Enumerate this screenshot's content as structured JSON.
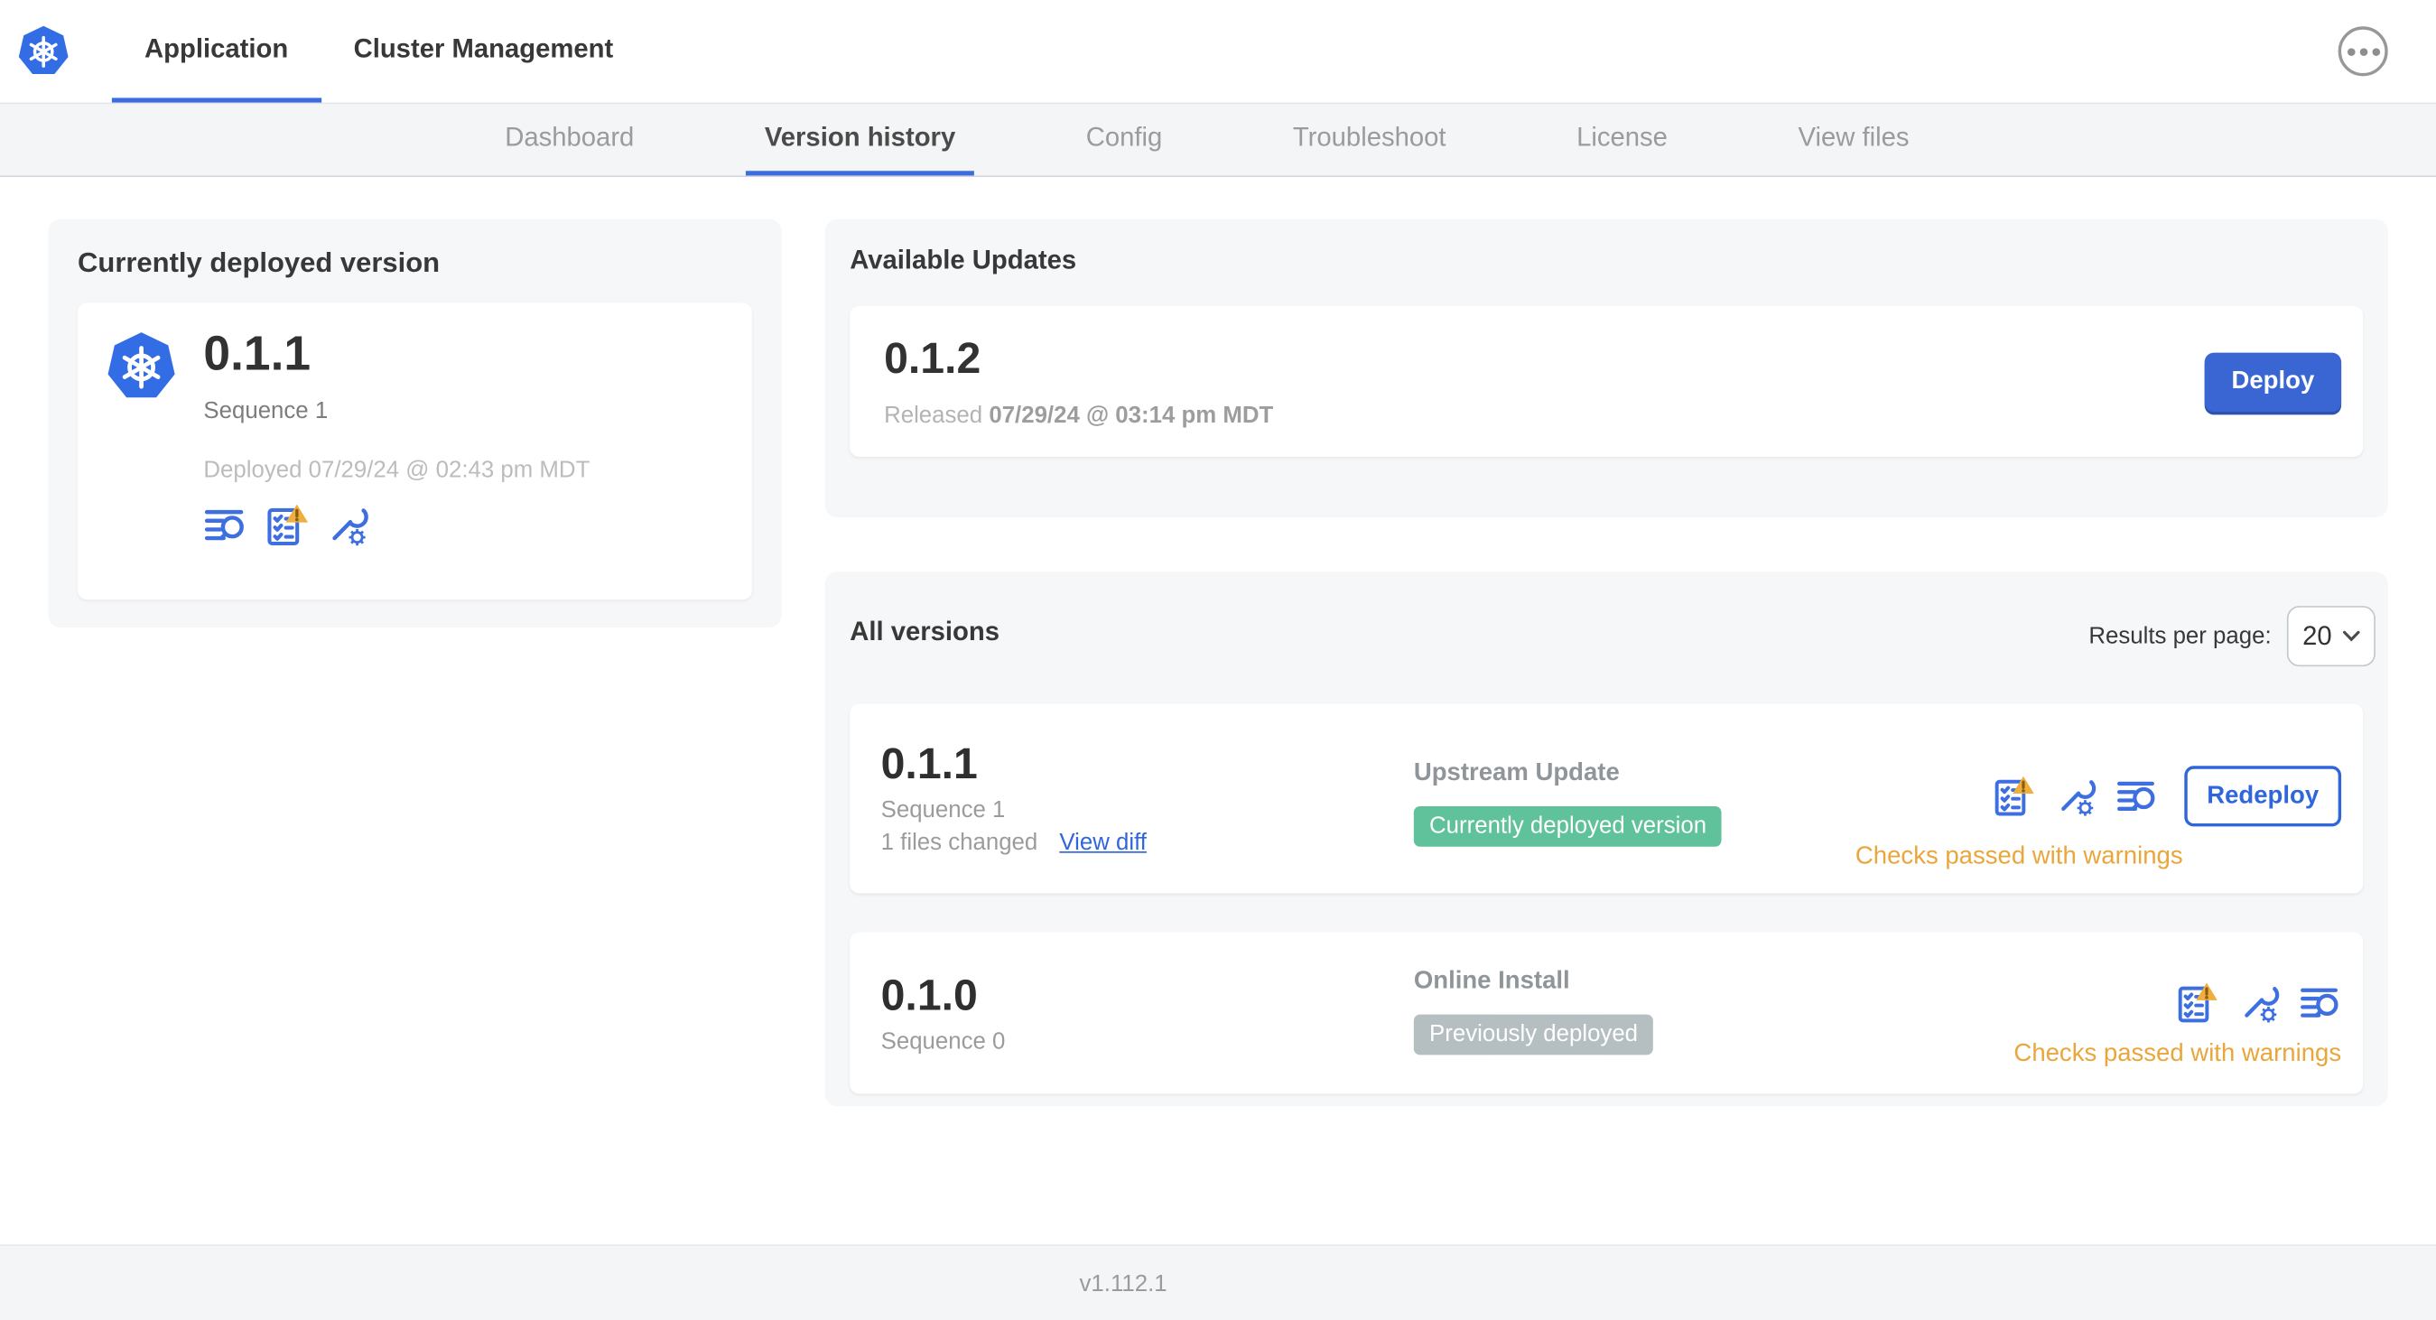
{
  "header": {
    "tabs": [
      "Application",
      "Cluster Management"
    ]
  },
  "subnav": {
    "tabs": [
      "Dashboard",
      "Version history",
      "Config",
      "Troubleshoot",
      "License",
      "View files"
    ],
    "active": "Version history"
  },
  "currently_deployed": {
    "title": "Currently deployed version",
    "version": "0.1.1",
    "sequence": "Sequence 1",
    "deployed_at": "Deployed 07/29/24 @ 02:43 pm MDT"
  },
  "available_updates": {
    "title": "Available Updates",
    "version": "0.1.2",
    "released_prefix": "Released",
    "released_at": "07/29/24 @ 03:14 pm MDT",
    "deploy_label": "Deploy"
  },
  "all_versions": {
    "title": "All versions",
    "results_per_page_label": "Results per page:",
    "results_per_page_value": "20",
    "rows": [
      {
        "version": "0.1.1",
        "sequence": "Sequence 1",
        "files_changed": "1 files changed",
        "view_diff_label": "View diff",
        "source": "Upstream Update",
        "badge": "Currently deployed version",
        "badge_color": "#5fc29a",
        "status": "Checks passed with warnings",
        "action_label": "Redeploy"
      },
      {
        "version": "0.1.0",
        "sequence": "Sequence 0",
        "source": "Online Install",
        "badge": "Previously deployed",
        "badge_color": "#b5bfc2",
        "status": "Checks passed with warnings"
      }
    ]
  },
  "footer": {
    "app_version": "v1.112.1"
  },
  "colors": {
    "accent_blue": "#3066db",
    "button_blue": "#3a66d4",
    "kubernetes_blue": "#326de6",
    "warning_amber": "#e9a63b",
    "success_green": "#5fc29a",
    "muted_badge_gray": "#b5bfc2"
  }
}
